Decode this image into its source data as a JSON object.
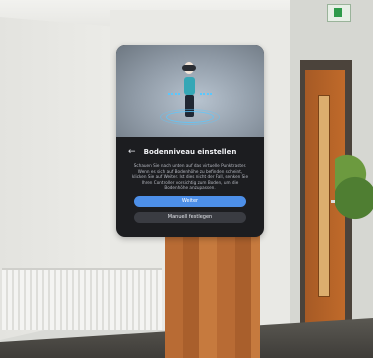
{
  "dialog": {
    "back_label": "←",
    "title": "Bodenniveau einstellen",
    "description": "Schauen Sie nach unten auf das virtuelle Punktraster. Wenn es sich auf Bodenhöhe zu befinden scheint, klicken Sie auf Weiter. Ist dies nicht der Fall, senken Sie Ihren Controller vorsichtig zum Boden, um die Bodenhöhe anzupassen.",
    "primary_button": "Weiter",
    "secondary_button": "Manuell festlegen"
  },
  "colors": {
    "panel_bg": "#1c1d20",
    "primary_button": "#4d8fe8",
    "secondary_button": "#3a3c42"
  },
  "icons": {
    "back": "back-arrow-icon",
    "exit_sign": "emergency-exit-sign-icon"
  }
}
